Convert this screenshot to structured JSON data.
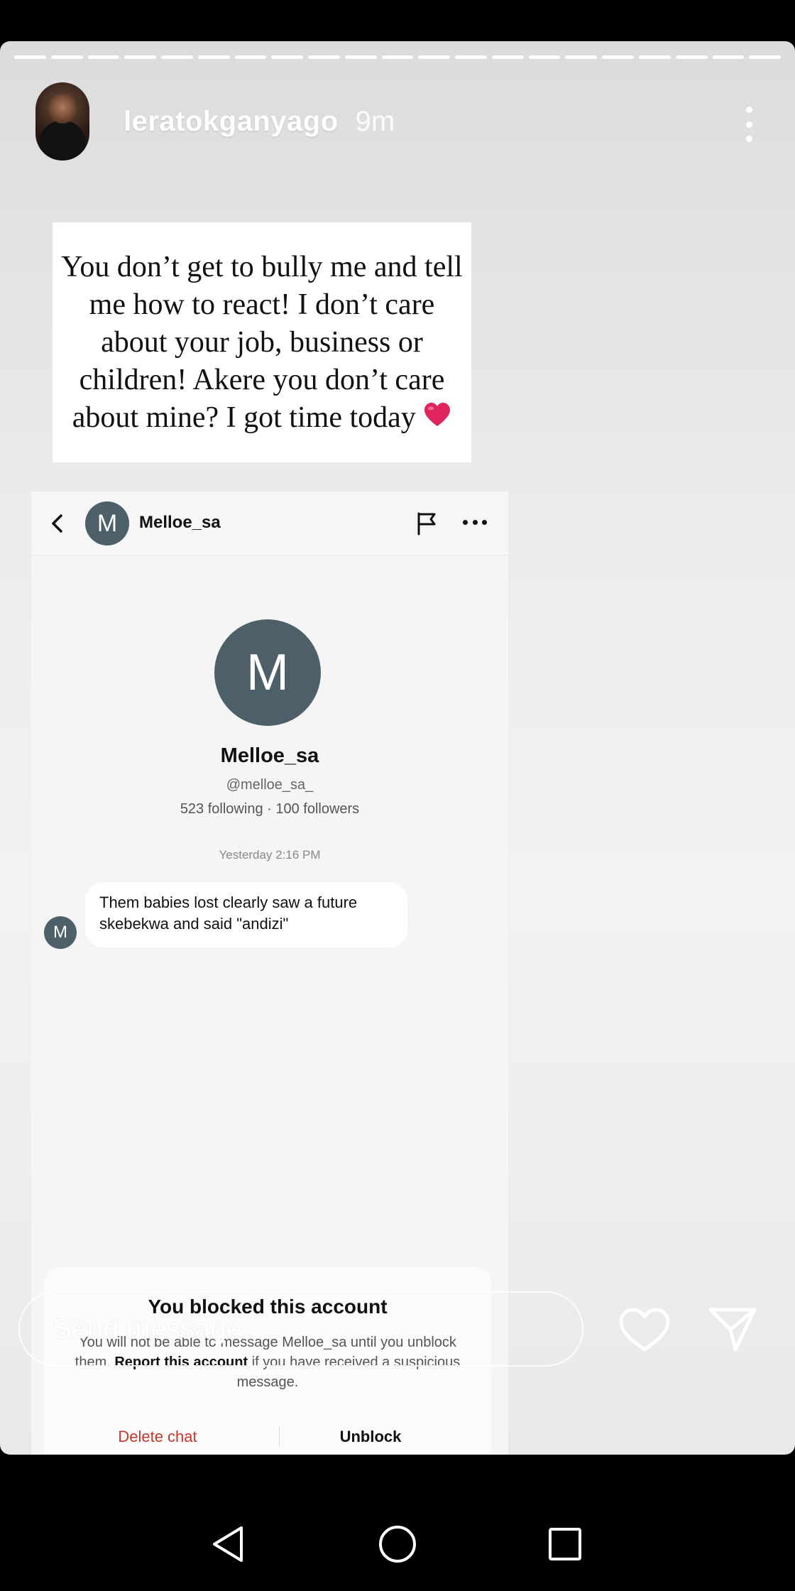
{
  "story": {
    "username": "leratokganyago",
    "time_ago": "9m",
    "caption": "You don’t get to bully me and tell me how to react! I don’t care about your job, business or children! Akere you don’t care about mine? I got time today",
    "caption_emoji": "heart-emoji"
  },
  "dm": {
    "header_name": "Melloe_sa",
    "avatar_letter": "M",
    "display_name": "Melloe_sa",
    "handle": "@melloe_sa_",
    "stats": "523 following · 100 followers",
    "timestamp": "Yesterday 2:16 PM",
    "message": "Them babies lost clearly saw a future skebekwa and said \"andizi\"",
    "blocked_title": "You blocked this account",
    "blocked_desc_prefix": "You will not be able to message Melloe_sa until you unblock them. ",
    "blocked_desc_link": "Report this account",
    "blocked_desc_suffix": " if you have received a suspicious message.",
    "delete_label": "Delete chat",
    "unblock_label": "Unblock"
  },
  "reply": {
    "placeholder": "Send message"
  },
  "icons": {
    "like": "heart-icon",
    "send": "send-icon",
    "more": "more-vertical-icon"
  },
  "colors": {
    "avatar_bg": "#4d5f69",
    "heart_red": "#e0245e",
    "delete_red": "#c0392b"
  }
}
